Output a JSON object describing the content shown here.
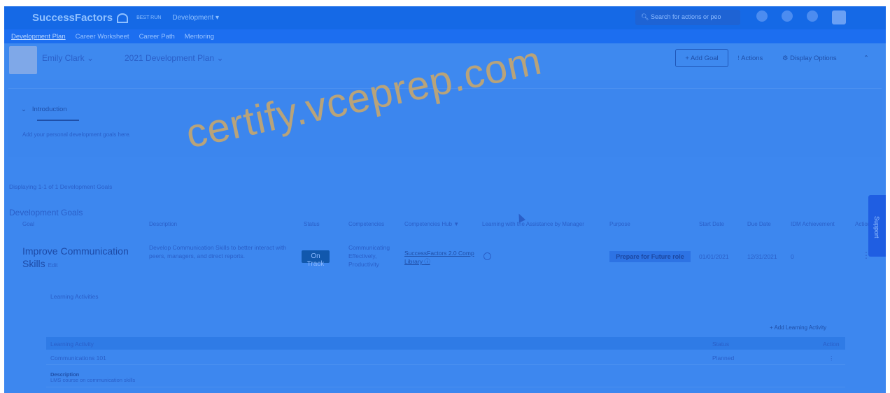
{
  "shell": {
    "logo": "SuccessFactors",
    "company": "BEST RUN",
    "module": "Development ▾",
    "search_placeholder": "Search for actions or peo"
  },
  "subnav": [
    "Development Plan",
    "Career Worksheet",
    "Career Path",
    "Mentoring"
  ],
  "header": {
    "person": "Emily Clark",
    "plan_title": "2021 Development Plan",
    "add_goal": "+ Add Goal",
    "actions": "⁝ Actions",
    "display_options": "⚙ Display Options",
    "collapse": "⌃"
  },
  "intro": {
    "tab": "Introduction",
    "text": "Add your personal development goals here."
  },
  "displaying": "Displaying 1-1 of 1 Development Goals",
  "section_title": "Development Goals",
  "table": {
    "headers": [
      "Goal",
      "Description",
      "Status",
      "Competencies",
      "Competencies Hub",
      "Learning with the Assistance by Manager",
      "Purpose",
      "Start Date",
      "Due Date",
      "IDM Achievement",
      "Actions"
    ],
    "goal": {
      "name": "Improve Communication Skills",
      "edit": "Edit",
      "description": "Develop Communication Skills to better interact with peers, managers, and direct reports.",
      "status": "On Track",
      "competencies": "Communicating Effectively, Productivity",
      "hub": "SuccessFactors 2.0 Comp Library ⓘ",
      "purpose": "Prepare for Future role",
      "start": "01/01/2021",
      "due": "12/31/2021",
      "idm": "0"
    }
  },
  "support": "Support",
  "learning": {
    "title": "Learning Activities",
    "add": "+ Add Learning Activity",
    "headers": [
      "Learning Activity",
      "Status",
      "Action"
    ],
    "row": {
      "activity": "Communications 101",
      "status": "Planned",
      "action": "⋮"
    },
    "desc_label": "Description",
    "desc": "LMS course on communication skills"
  },
  "watermark": "certify.vceprep.com",
  "colors": {
    "overlay": "#3d87ef",
    "shell": "#1569e6",
    "badge": "#1158ad"
  }
}
